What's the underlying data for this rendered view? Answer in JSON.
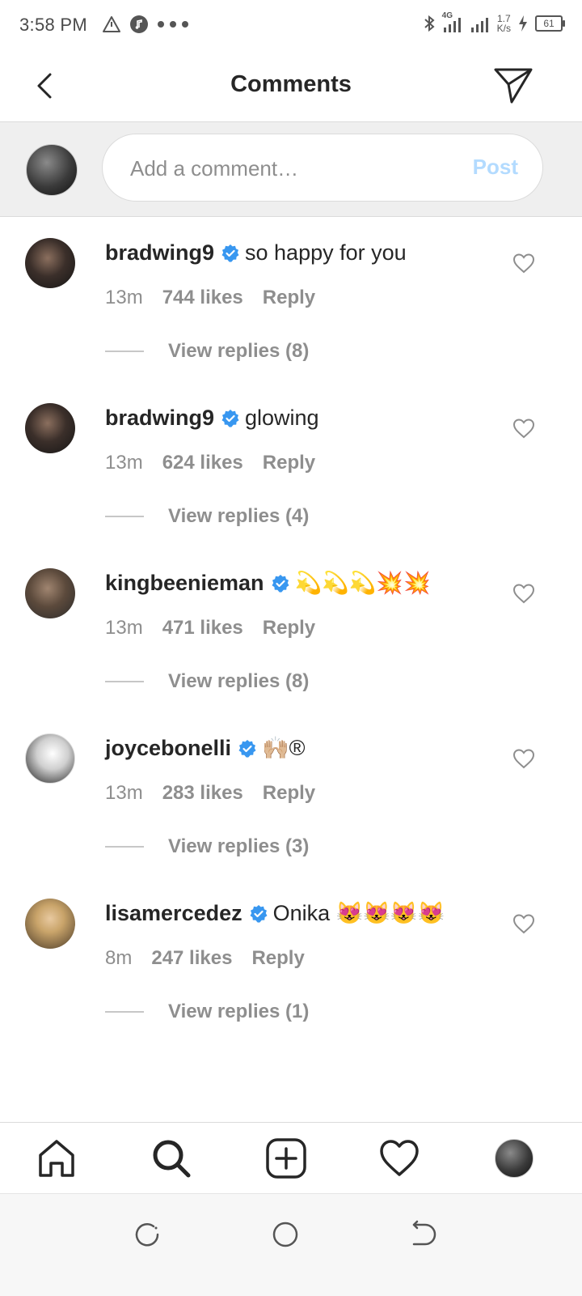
{
  "status_bar": {
    "time": "3:58 PM",
    "network": "4G",
    "speed_value": "1.7",
    "speed_unit": "K/s",
    "battery": "61"
  },
  "header": {
    "title": "Comments"
  },
  "composer": {
    "placeholder": "Add a comment…",
    "post_label": "Post"
  },
  "comments": [
    {
      "user": "bradwing9",
      "text": "so happy for you",
      "time": "13m",
      "likes": "744 likes",
      "reply": "Reply",
      "view_replies": "View replies (8)"
    },
    {
      "user": "bradwing9",
      "text": "glowing",
      "time": "13m",
      "likes": "624 likes",
      "reply": "Reply",
      "view_replies": "View replies (4)"
    },
    {
      "user": "kingbeenieman",
      "text": "💫💫💫💥💥",
      "time": "13m",
      "likes": "471 likes",
      "reply": "Reply",
      "view_replies": "View replies (8)"
    },
    {
      "user": "joycebonelli",
      "text": "🙌🏼®",
      "time": "13m",
      "likes": "283 likes",
      "reply": "Reply",
      "view_replies": "View replies (3)"
    },
    {
      "user": "lisamercedez",
      "text": "Onika 😻😻😻😻",
      "time": "8m",
      "likes": "247 likes",
      "reply": "Reply",
      "view_replies": "View replies (1)"
    }
  ],
  "colors": {
    "verified": "#3897f0",
    "post_disabled": "#b3dbff",
    "meta_gray": "#8e8e8e"
  }
}
